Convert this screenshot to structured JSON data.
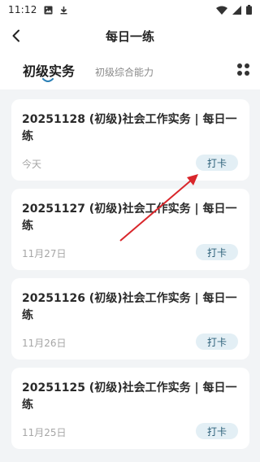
{
  "status_bar": {
    "time": "11:12",
    "icons": [
      "image-icon",
      "download-icon",
      "wifi-icon",
      "signal-icon",
      "battery-icon"
    ]
  },
  "header": {
    "title": "每日一练",
    "back_icon": "back-arrow-icon"
  },
  "tabs": {
    "active": "初级实务",
    "inactive": "初级综合能力",
    "grid_icon": "grid-dots-icon"
  },
  "cards": [
    {
      "title": "20251128 (初级)社会工作实务 | 每日一练",
      "date": "今天",
      "button": "打卡"
    },
    {
      "title": "20251127 (初级)社会工作实务 | 每日一练",
      "date": "11月27日",
      "button": "打卡"
    },
    {
      "title": "20251126 (初级)社会工作实务 | 每日一练",
      "date": "11月26日",
      "button": "打卡"
    },
    {
      "title": "20251125 (初级)社会工作实务 | 每日一练",
      "date": "11月25日",
      "button": "打卡"
    }
  ],
  "colors": {
    "accent": "#2b5f78",
    "button_bg": "#e3eff5",
    "annotation_arrow": "#d9262b",
    "list_bg": "#f2f4f6"
  }
}
